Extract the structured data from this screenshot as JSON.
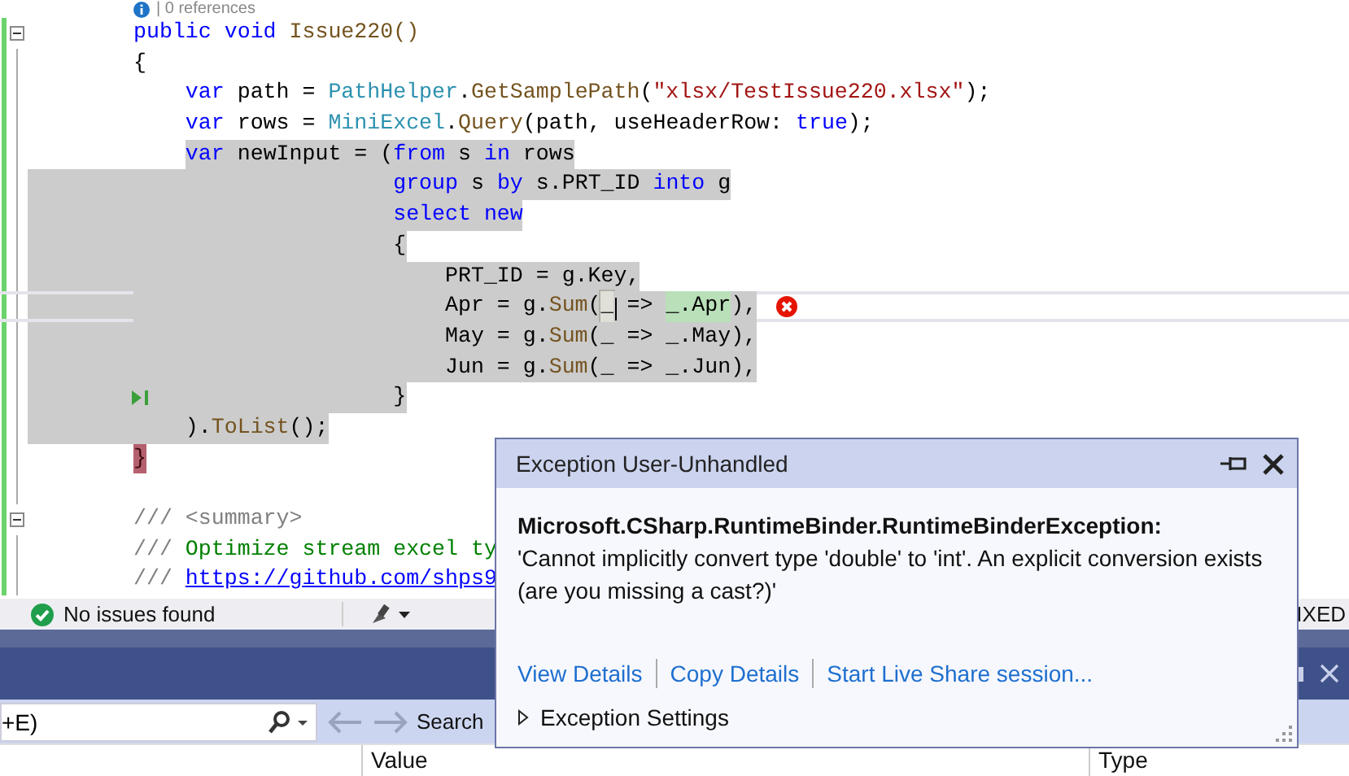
{
  "editor": {
    "codelens": "| 0 references",
    "lines": [
      {
        "tokens": [
          {
            "text": "public void",
            "kind": "kw"
          },
          {
            "text": " Issue220()",
            "kind": "method"
          }
        ],
        "selected": false,
        "margin_selected": false,
        "current": false,
        "collapse": true,
        "error": false,
        "run_to_click": false
      },
      {
        "tokens": [
          {
            "text": "{",
            "kind": "plain"
          }
        ],
        "selected": false,
        "margin_selected": false,
        "current": false,
        "collapse": false,
        "error": false,
        "run_to_click": false
      },
      {
        "tokens": [
          {
            "text": "    var",
            "kind": "kw"
          },
          {
            "text": " path = ",
            "kind": "plain"
          },
          {
            "text": "PathHelper",
            "kind": "type"
          },
          {
            "text": ".",
            "kind": "plain"
          },
          {
            "text": "GetSamplePath",
            "kind": "method"
          },
          {
            "text": "(",
            "kind": "plain"
          },
          {
            "text": "\"xlsx/TestIssue220.xlsx\"",
            "kind": "str"
          },
          {
            "text": ");",
            "kind": "plain"
          }
        ],
        "selected": false,
        "margin_selected": false,
        "current": false,
        "collapse": false,
        "error": false,
        "run_to_click": false
      },
      {
        "tokens": [
          {
            "text": "    var",
            "kind": "kw"
          },
          {
            "text": " rows = ",
            "kind": "plain"
          },
          {
            "text": "MiniExcel",
            "kind": "type"
          },
          {
            "text": ".",
            "kind": "plain"
          },
          {
            "text": "Query",
            "kind": "method"
          },
          {
            "text": "(path, useHeaderRow: ",
            "kind": "plain"
          },
          {
            "text": "true",
            "kind": "kw"
          },
          {
            "text": ");",
            "kind": "plain"
          }
        ],
        "selected": false,
        "margin_selected": false,
        "current": false,
        "collapse": false,
        "error": false,
        "run_to_click": false
      },
      {
        "tokens": [
          {
            "text": "    var",
            "kind": "kw"
          },
          {
            "text": " newInput = (",
            "kind": "plain"
          },
          {
            "text": "from",
            "kind": "kw"
          },
          {
            "text": " s ",
            "kind": "plain"
          },
          {
            "text": "in",
            "kind": "kw"
          },
          {
            "text": " rows",
            "kind": "plain"
          }
        ],
        "selected": true,
        "margin_selected": false,
        "current": false,
        "collapse": false,
        "error": false,
        "run_to_click": false
      },
      {
        "tokens": [
          {
            "text": "                    group",
            "kind": "kw"
          },
          {
            "text": " s ",
            "kind": "plain"
          },
          {
            "text": "by",
            "kind": "kw"
          },
          {
            "text": " s.PRT_ID ",
            "kind": "plain"
          },
          {
            "text": "into",
            "kind": "kw"
          },
          {
            "text": " g",
            "kind": "plain"
          }
        ],
        "selected": true,
        "margin_selected": true,
        "current": false,
        "collapse": false,
        "error": false,
        "run_to_click": false
      },
      {
        "tokens": [
          {
            "text": "                    select new",
            "kind": "kw"
          }
        ],
        "selected": true,
        "margin_selected": true,
        "current": false,
        "collapse": false,
        "error": false,
        "run_to_click": false
      },
      {
        "tokens": [
          {
            "text": "                    {",
            "kind": "plain"
          }
        ],
        "selected": true,
        "margin_selected": true,
        "current": false,
        "collapse": false,
        "error": false,
        "run_to_click": false
      },
      {
        "tokens": [
          {
            "text": "                        PRT_ID = g.Key,",
            "kind": "plain"
          }
        ],
        "selected": true,
        "margin_selected": true,
        "current": false,
        "collapse": false,
        "error": false,
        "run_to_click": false
      },
      {
        "tokens": [
          {
            "text": "                        Apr = g.",
            "kind": "plain"
          },
          {
            "text": "Sum",
            "kind": "method"
          },
          {
            "text": "(",
            "kind": "plain"
          },
          {
            "text": "_",
            "kind": "ref"
          },
          {
            "text": " => ",
            "kind": "plain"
          },
          {
            "text": "_.Apr",
            "kind": "match"
          },
          {
            "text": "),",
            "kind": "plain"
          }
        ],
        "selected": true,
        "margin_selected": true,
        "current": true,
        "collapse": false,
        "error": true,
        "run_to_click": false
      },
      {
        "tokens": [
          {
            "text": "                        May = g.",
            "kind": "plain"
          },
          {
            "text": "Sum",
            "kind": "method"
          },
          {
            "text": "(_ => _.May),",
            "kind": "plain"
          }
        ],
        "selected": true,
        "margin_selected": true,
        "current": false,
        "collapse": false,
        "error": false,
        "run_to_click": false
      },
      {
        "tokens": [
          {
            "text": "                        Jun = g.",
            "kind": "plain"
          },
          {
            "text": "Sum",
            "kind": "method"
          },
          {
            "text": "(_ => _.Jun),",
            "kind": "plain"
          }
        ],
        "selected": true,
        "margin_selected": true,
        "current": false,
        "collapse": false,
        "error": false,
        "run_to_click": false
      },
      {
        "tokens": [
          {
            "text": "                    }",
            "kind": "plain"
          }
        ],
        "selected": true,
        "margin_selected": true,
        "current": false,
        "collapse": false,
        "error": false,
        "run_to_click": true
      },
      {
        "tokens": [
          {
            "text": "    ).",
            "kind": "plain"
          },
          {
            "text": "ToList",
            "kind": "method"
          },
          {
            "text": "();",
            "kind": "plain"
          }
        ],
        "selected": true,
        "margin_selected": true,
        "current": false,
        "collapse": false,
        "error": false,
        "run_to_click": false
      },
      {
        "tokens": [
          {
            "text": "}",
            "kind": "brace"
          }
        ],
        "selected": false,
        "margin_selected": false,
        "current": false,
        "collapse": false,
        "error": false,
        "run_to_click": false
      },
      {
        "selected": false,
        "margin_selected": false,
        "current": false,
        "collapse": false,
        "error": false,
        "run_to_click": false
      },
      {
        "tokens": [
          {
            "text": "/// ",
            "kind": "comment"
          },
          {
            "text": "<summary>",
            "kind": "comment"
          }
        ],
        "selected": false,
        "margin_selected": false,
        "current": false,
        "collapse": true,
        "error": false,
        "run_to_click": false
      },
      {
        "tokens": [
          {
            "text": "/// ",
            "kind": "comment"
          },
          {
            "text": "Optimize stream excel ty",
            "kind": "doc"
          }
        ],
        "selected": false,
        "margin_selected": false,
        "current": false,
        "collapse": false,
        "error": false,
        "run_to_click": false
      },
      {
        "tokens": [
          {
            "text": "/// ",
            "kind": "comment"
          },
          {
            "text": "https://github.com/shps9",
            "kind": "link"
          }
        ],
        "selected": false,
        "margin_selected": false,
        "current": false,
        "collapse": false,
        "error": false,
        "run_to_click": false
      }
    ]
  },
  "status_bar": {
    "issues": "No issues found",
    "right_text": "IXED"
  },
  "tool_window": {
    "search_value": "+E)",
    "search_label": "Search",
    "columns": [
      "Value",
      "Type"
    ]
  },
  "exception_popup": {
    "title": "Exception User-Unhandled",
    "exception": "Microsoft.CSharp.RuntimeBinder.RuntimeBinderException:",
    "message": "'Cannot implicitly convert type 'double' to 'int'. An explicit conversion exists (are you missing a cast?)'",
    "links": [
      "View Details",
      "Copy Details",
      "Start Live Share session..."
    ],
    "settings": {
      "label": "Exception Settings",
      "expanded": false
    }
  }
}
